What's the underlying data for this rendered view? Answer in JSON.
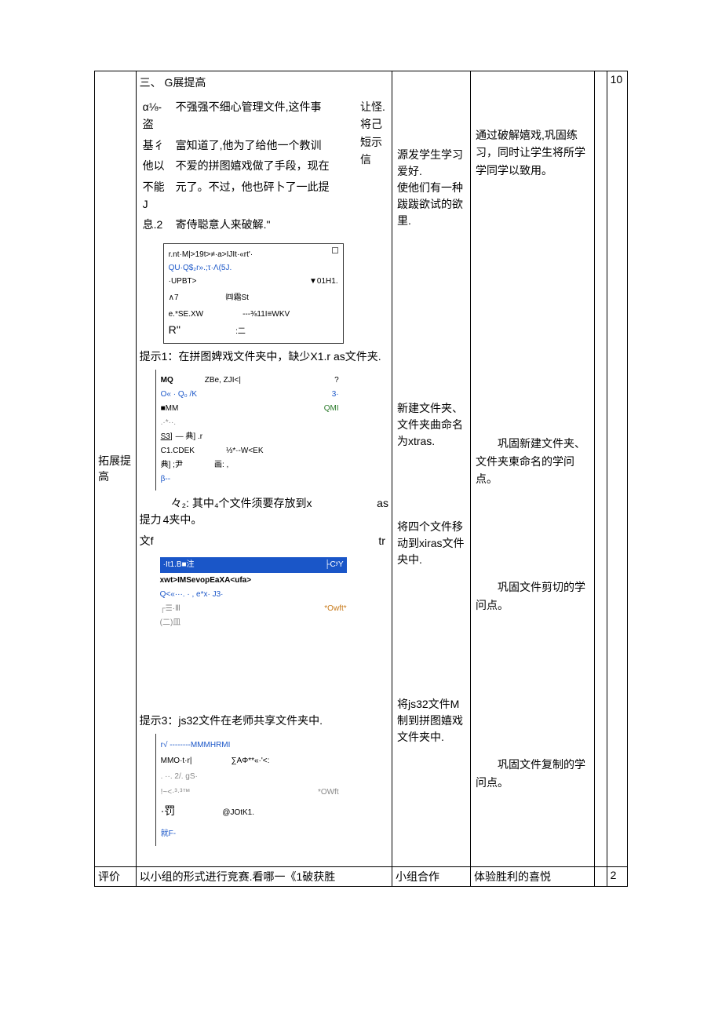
{
  "row1": {
    "label": "拓展提高",
    "section_title": "三、    G展提高",
    "story": {
      "l1a": "α⅛-盗",
      "l1b": "不强强不细心管理文件,这件事",
      "l2a": "  基彳",
      "l2b": "富知道了,他为了给他一个教训",
      "l3a": "他以",
      "l3b": "不爱的拼图嬉戏做了手段，现在",
      "l4a": "不能J",
      "l4b": "元了。不过，他也砰卜了一此提",
      "l5a": "  息.2",
      "l5b": "寄侍聪意人来破解.\"",
      "r1": "让怪.",
      "r2": "将己",
      "r3": "短示",
      "r4": "信"
    },
    "box1": {
      "l1": "r.nt·M|>19t>≠·a>IJIt·«rt'·",
      "l2": "QU·Q$₂r».;τ·Λ(5J.",
      "l3_left": "  ·UPBT>",
      "l3_right": "▼01H1.",
      "l4_left": "∧7",
      "l4_right": "㈣霜St",
      "l5_left": "e.*SE.XW",
      "l5_right": "---⅜11I≡WKV",
      "l6_left": "R''",
      "l6_right": ":二"
    },
    "hint1": "提示1：在拼图婢戏文件夹中，缺少X1.r   as文件夹.",
    "box2": {
      "l1_left": "MQ",
      "l1_mid": "ZBe,  ZJI<|",
      "l1_right": "?",
      "l2_left": "O« · Q₀ /K",
      "l2_right": "3·",
      "l3_left": "    ■MM",
      "l3_right": "QMI",
      "l4": ".·*··.",
      "l5_left": "S3]",
      "l5_mid": "—          典]  .r",
      "l6_left": "        C1.CDEK",
      "l6_right": "⅓*·-W<EK",
      "l7_left": "典]  ;尹",
      "l7_right": "画: ,",
      "l8": "β--"
    },
    "hint2_pre": "提力",
    "hint2_line": "々₂: 其中₄个文件须要存放到x",
    "hint2_tail": "as",
    "hint2_end": "4夹中。",
    "hint2_suf": "文f",
    "hint2_tr": "tr",
    "box3": {
      "bar_left": "·It1.B■注",
      "bar_right": "├CʸY",
      "l1": "xwt>IMSevopEaXA<ufa>",
      "l2": "Q<«···. · , e*х· J3·",
      "l3_left": "┌☰·Ⅲ",
      "l3_right": "*Owft*",
      "l4": "(二)皿"
    },
    "hint3": "提示3：js32文件在老师共享文件夹中.",
    "box4": {
      "l1": "r√ --------MMMHRMI",
      "l2_left": "    MMO·t·r|",
      "l2_right": "∑AΦ**«·'<:",
      "l3": " . ··. 2/.  gS·",
      "l4_left": "!~<·³·³™",
      "l4_right": "*OWft",
      "l5_left": "·罚",
      "l5_right": "@JOtK1.",
      "l6": "就F-"
    },
    "col3_a": "源发学生学习爱好.\n使他们有一种跋跋欲试的欲里.",
    "col3_b": "新建文件夹、文件夹曲命名为xtras.",
    "col3_c": "将四个文件移动到xiras文件央中.",
    "col3_d": "将js32文件M制到拼图嬉戏文件夹中.",
    "col4_a": "通过破解嬉戏,巩固练习，同时让学生将所学学同学以致用。",
    "col4_b": "巩固新建文件夹、文件夹柬命名的学问点。",
    "col4_c": "巩固文件剪切的学问点。",
    "col4_d": "巩固文件复制的学问点。",
    "col6": "10"
  },
  "row2": {
    "label": "评价",
    "col2": "以小组的形式进行竞赛.看哪一《1破获胜",
    "col3": "小组合作",
    "col4": "体验胜利的喜悦",
    "col6": "2"
  }
}
